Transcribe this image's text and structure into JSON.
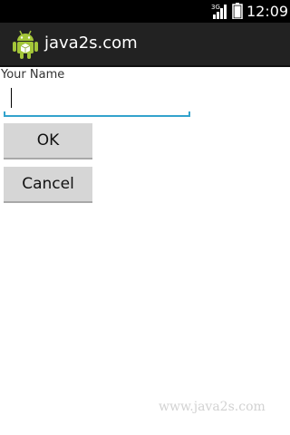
{
  "status_bar": {
    "network": "3G",
    "time": "12:09"
  },
  "action_bar": {
    "icon": "android-icon",
    "title": "java2s.com"
  },
  "form": {
    "name_label": "Your Name",
    "name_value": "",
    "ok_label": "OK",
    "cancel_label": "Cancel"
  },
  "watermark": "www.java2s.com",
  "colors": {
    "status_bar": "#000000",
    "action_bar": "#222222",
    "input_accent": "#33a3cc",
    "button": "#d6d6d6"
  }
}
